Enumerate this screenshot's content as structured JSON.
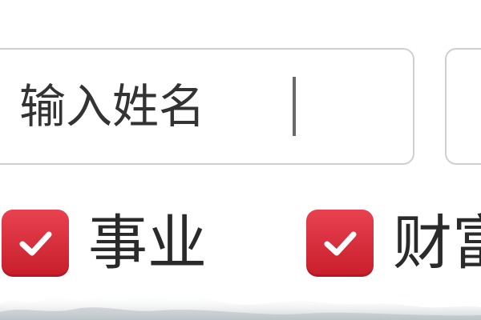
{
  "form": {
    "name_field": {
      "placeholder": "输入姓名",
      "value": ""
    },
    "second_field": {
      "value": ""
    }
  },
  "options": [
    {
      "label": "事业",
      "checked": true
    },
    {
      "label": "财富",
      "checked": true
    }
  ],
  "colors": {
    "checkbox_fill": "#d42a38",
    "border": "#cfcfcf",
    "text": "#2a2a2a"
  }
}
